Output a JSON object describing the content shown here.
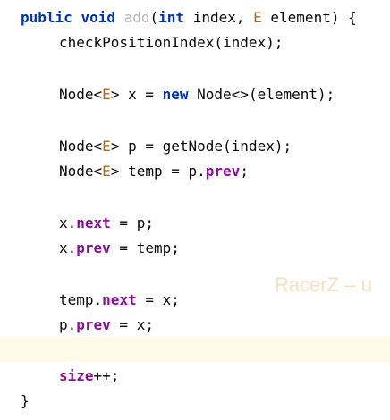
{
  "code": {
    "line1": {
      "kw_public": "public",
      "kw_void": "void",
      "method": "add",
      "paren_open": "(",
      "kw_int": "int",
      "p1": " index, ",
      "type_e": "E",
      "p2": " element) {"
    },
    "line2": {
      "text": "checkPositionIndex(index);"
    },
    "line3": {
      "a": "Node<",
      "type_e": "E",
      "b": "> x = ",
      "kw_new": "new",
      "c": " Node<>(element);"
    },
    "line4": {
      "a": "Node<",
      "type_e": "E",
      "b": "> p = getNode(index);"
    },
    "line5": {
      "a": "Node<",
      "type_e": "E",
      "b": "> temp = p.",
      "field": "prev",
      "c": ";"
    },
    "line6": {
      "a": "x.",
      "field": "next",
      "b": " = p;"
    },
    "line7": {
      "a": "x.",
      "field": "prev",
      "b": " = temp;"
    },
    "line8": {
      "a": "temp.",
      "field": "next",
      "b": " = x;"
    },
    "line9": {
      "a": "p.",
      "field": "prev",
      "b": " = x;"
    },
    "line10": {
      "field": "size",
      "b": "++;"
    },
    "line11": {
      "text": "}"
    }
  },
  "watermark": "RacerZ – u",
  "colors": {
    "keyword": "#0033b3",
    "method_name": "#b4b4b4",
    "type_param": "#9f6b2e",
    "field": "#871094",
    "caret_line": "#fffbe8",
    "watermark": "#f5dfbf"
  }
}
